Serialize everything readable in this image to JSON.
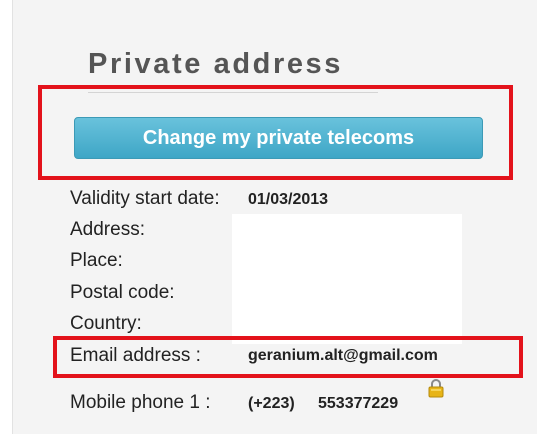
{
  "section": {
    "title": "Private address"
  },
  "actions": {
    "change_telecoms_label": "Change my private telecoms"
  },
  "fields": {
    "validity_start_date": {
      "label": "Validity start date:",
      "value": "01/03/2013"
    },
    "address": {
      "label": "Address:",
      "value": ""
    },
    "place": {
      "label": "Place:",
      "value": ""
    },
    "postal_code": {
      "label": "Postal code:",
      "value": ""
    },
    "country": {
      "label": "Country:",
      "value": ""
    },
    "email": {
      "label": "Email address :",
      "value": "geranium.alt@gmail.com"
    },
    "mobile_phone_1": {
      "label": "Mobile phone 1 :",
      "country_code": "(+223)",
      "number": "553377229"
    }
  },
  "icons": {
    "mobile_lock": "lock-icon"
  },
  "colors": {
    "highlight": "#e3121b",
    "button_top": "#69c2dc",
    "button_bottom": "#3ea6c6",
    "lock_body": "#e7b416"
  }
}
